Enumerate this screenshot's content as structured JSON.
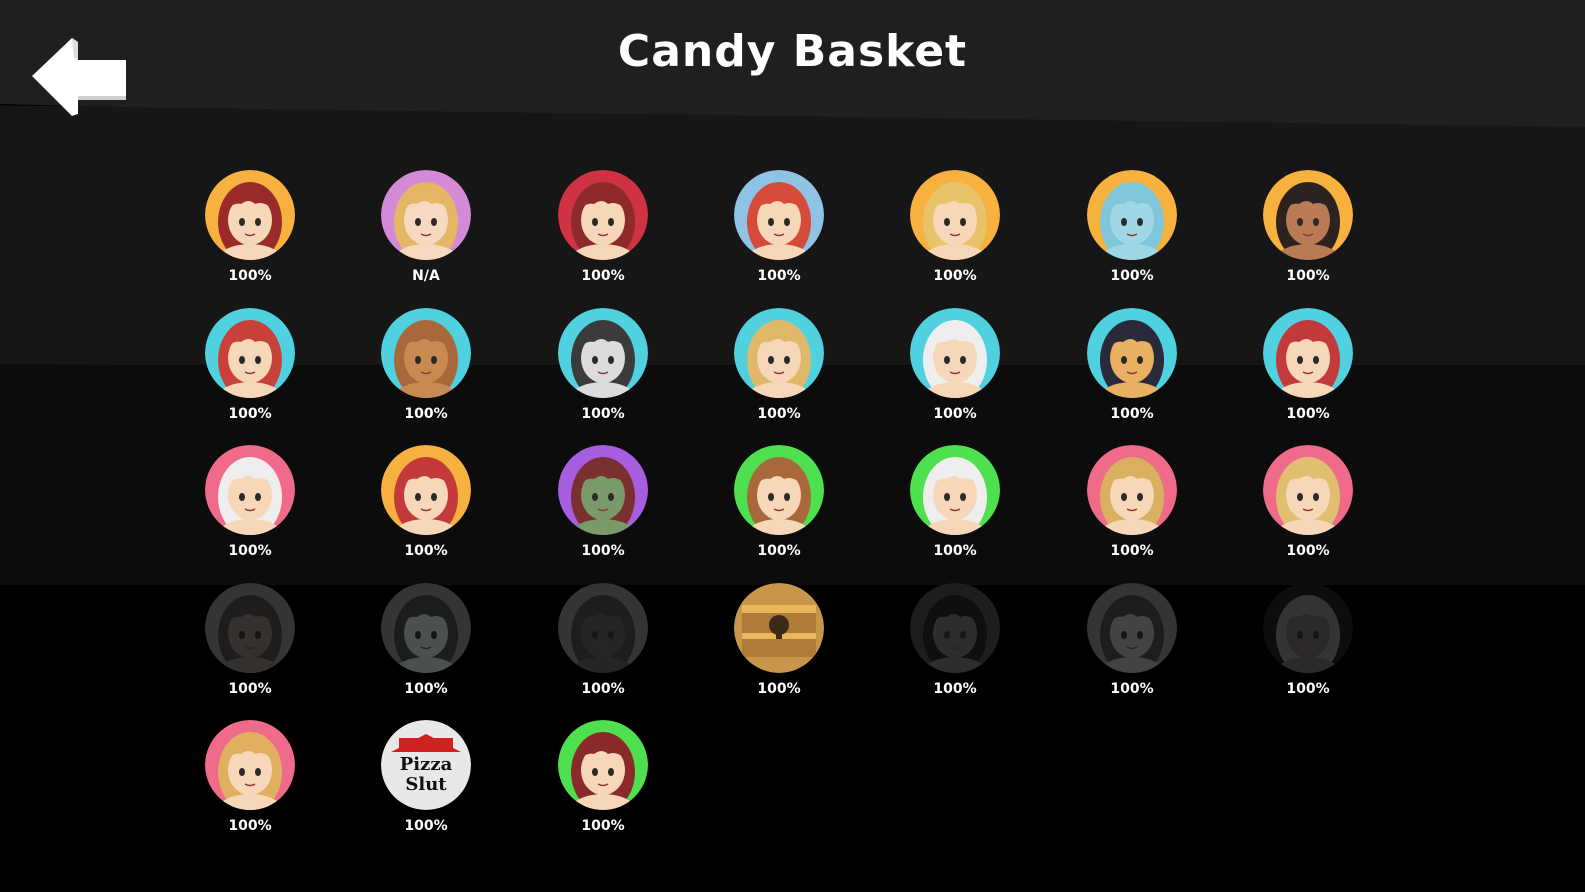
{
  "header": {
    "title": "Candy Basket",
    "back_icon": "arrow-left-icon"
  },
  "characters": [
    {
      "id": "char-1",
      "progress": "100%",
      "bg": "#f7b13f",
      "hair": "#9b2b2b",
      "skin": "#f6d7b8",
      "state": "unlocked"
    },
    {
      "id": "char-2",
      "progress": "N/A",
      "bg": "#d48ad6",
      "hair": "#e3b766",
      "skin": "#f7d8c0",
      "state": "unlocked"
    },
    {
      "id": "char-3",
      "progress": "100%",
      "bg": "#cf3242",
      "hair": "#8e2a2a",
      "skin": "#f6d7b8",
      "state": "unlocked"
    },
    {
      "id": "char-4",
      "progress": "100%",
      "bg": "#8ec3e6",
      "hair": "#d64a3a",
      "skin": "#f6d7b8",
      "state": "unlocked"
    },
    {
      "id": "char-5",
      "progress": "100%",
      "bg": "#f7b13f",
      "hair": "#e8c36a",
      "skin": "#f6d7b8",
      "state": "unlocked"
    },
    {
      "id": "char-6",
      "progress": "100%",
      "bg": "#f7b13f",
      "hair": "#7fc6d8",
      "skin": "#9fd8e4",
      "state": "unlocked"
    },
    {
      "id": "char-7",
      "progress": "100%",
      "bg": "#f7b13f",
      "hair": "#2c2320",
      "skin": "#b97a55",
      "state": "unlocked"
    },
    {
      "id": "char-8",
      "progress": "100%",
      "bg": "#4fd1df",
      "hair": "#c9423a",
      "skin": "#f6d7b8",
      "state": "unlocked"
    },
    {
      "id": "char-9",
      "progress": "100%",
      "bg": "#4fd1df",
      "hair": "#a8683a",
      "skin": "#c98a52",
      "state": "unlocked"
    },
    {
      "id": "char-10",
      "progress": "100%",
      "bg": "#4fd1df",
      "hair": "#3b3b3b",
      "skin": "#dcdcdc",
      "state": "unlocked"
    },
    {
      "id": "char-11",
      "progress": "100%",
      "bg": "#4fd1df",
      "hair": "#e0b86a",
      "skin": "#f6d7b8",
      "state": "unlocked"
    },
    {
      "id": "char-12",
      "progress": "100%",
      "bg": "#4fd1df",
      "hair": "#eeeeee",
      "skin": "#f6d7b8",
      "state": "unlocked"
    },
    {
      "id": "char-13",
      "progress": "100%",
      "bg": "#4fd1df",
      "hair": "#2a2a3a",
      "skin": "#e8b060",
      "state": "unlocked"
    },
    {
      "id": "char-14",
      "progress": "100%",
      "bg": "#4fd1df",
      "hair": "#c33a3a",
      "skin": "#f6d7b8",
      "state": "unlocked"
    },
    {
      "id": "char-15",
      "progress": "100%",
      "bg": "#f06a8a",
      "hair": "#eeeeee",
      "skin": "#f6d7b8",
      "state": "unlocked"
    },
    {
      "id": "char-16",
      "progress": "100%",
      "bg": "#f7b13f",
      "hair": "#c33a3a",
      "skin": "#f6d7b8",
      "state": "unlocked"
    },
    {
      "id": "char-17",
      "progress": "100%",
      "bg": "#a65de0",
      "hair": "#7a3030",
      "skin": "#7a9a6a",
      "state": "unlocked"
    },
    {
      "id": "char-18",
      "progress": "100%",
      "bg": "#4fe04f",
      "hair": "#a8683a",
      "skin": "#f6d7b8",
      "state": "unlocked"
    },
    {
      "id": "char-19",
      "progress": "100%",
      "bg": "#4fe04f",
      "hair": "#eeeeee",
      "skin": "#f6d7b8",
      "state": "unlocked"
    },
    {
      "id": "char-20",
      "progress": "100%",
      "bg": "#f06a8a",
      "hair": "#d8b060",
      "skin": "#f6d7b8",
      "state": "unlocked"
    },
    {
      "id": "char-21",
      "progress": "100%",
      "bg": "#f06a8a",
      "hair": "#e0c070",
      "skin": "#f6d7b8",
      "state": "unlocked"
    },
    {
      "id": "char-22",
      "progress": "100%",
      "bg": "#6a6a6a",
      "hair": "#3a3a3a",
      "skin": "#8a5a40",
      "state": "shadowed"
    },
    {
      "id": "char-23",
      "progress": "100%",
      "bg": "#6a6a6a",
      "hair": "#2e3a3a",
      "skin": "#7aa8a8",
      "state": "shadowed"
    },
    {
      "id": "char-24",
      "progress": "100%",
      "bg": "#6a6a6a",
      "hair": "#3a3a3a",
      "skin": "#4a4a4a",
      "state": "shadowed"
    },
    {
      "id": "char-25",
      "progress": "100%",
      "bg": "#c8964a",
      "hair": "#e8b85a",
      "skin": "#e8b85a",
      "state": "chest"
    },
    {
      "id": "char-26",
      "progress": "100%",
      "bg": "#3a3a3a",
      "hair": "#1e1e1e",
      "skin": "#5a5a5a",
      "state": "shadowed"
    },
    {
      "id": "char-27",
      "progress": "100%",
      "bg": "#6a6a6a",
      "hair": "#3a3a3a",
      "skin": "#7a8a7a",
      "state": "shadowed"
    },
    {
      "id": "char-28",
      "progress": "100%",
      "bg": "#1a1a1a",
      "hair": "#7a6650",
      "skin": "#6a5040",
      "state": "shadowed"
    },
    {
      "id": "char-29",
      "progress": "100%",
      "bg": "#f06a8a",
      "hair": "#e0b060",
      "skin": "#f6d7b8",
      "state": "unlocked"
    },
    {
      "id": "char-30",
      "progress": "100%",
      "bg": "#e8e8e8",
      "hair": "#d02020",
      "skin": "#111111",
      "state": "logo",
      "logo_line1": "Pizza",
      "logo_line2": "Slut"
    },
    {
      "id": "char-31",
      "progress": "100%",
      "bg": "#4fe04f",
      "hair": "#8a2a2a",
      "skin": "#f6d7b8",
      "state": "unlocked"
    }
  ]
}
